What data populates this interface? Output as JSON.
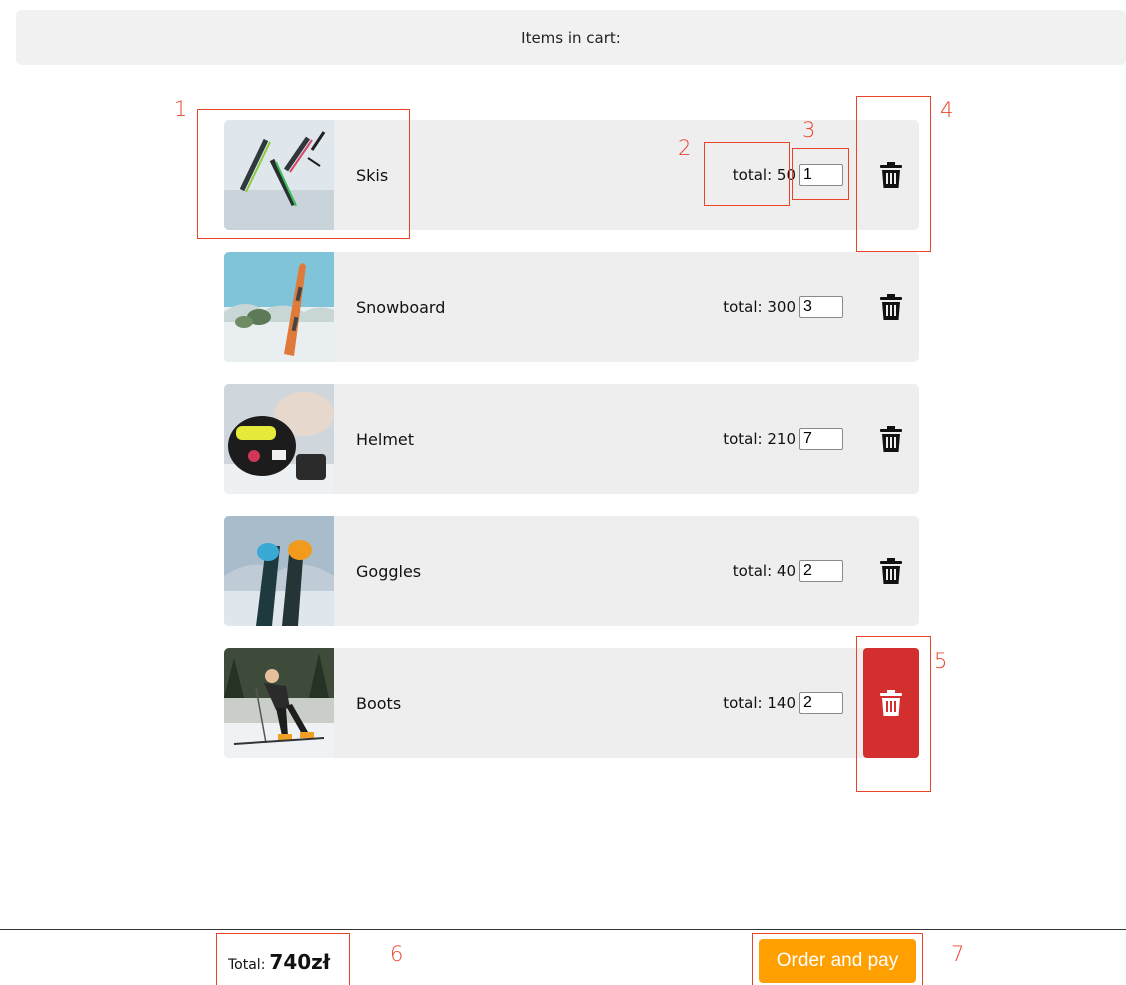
{
  "header": {
    "title": "Items in cart:"
  },
  "cart": {
    "items": [
      {
        "name": "Skis",
        "total_label": "total: 50",
        "quantity": "1",
        "image": "skis-photo"
      },
      {
        "name": "Snowboard",
        "total_label": "total: 300",
        "quantity": "3",
        "image": "snowboard-photo"
      },
      {
        "name": "Helmet",
        "total_label": "total: 210",
        "quantity": "7",
        "image": "helmet-photo"
      },
      {
        "name": "Goggles",
        "total_label": "total: 40",
        "quantity": "2",
        "image": "goggles-photo"
      },
      {
        "name": "Boots",
        "total_label": "total: 140",
        "quantity": "2",
        "image": "boots-photo"
      }
    ],
    "delete_icon": "trash-icon"
  },
  "footer": {
    "total_label": "Total:",
    "total_value": "740zł",
    "order_button": "Order and pay"
  },
  "annotations": [
    "1",
    "2",
    "3",
    "4",
    "5",
    "6",
    "7"
  ],
  "colors": {
    "accent": "#ffa000",
    "danger": "#d32f2f",
    "annotation": "#e8442c",
    "row_bg": "#eeeeee"
  }
}
